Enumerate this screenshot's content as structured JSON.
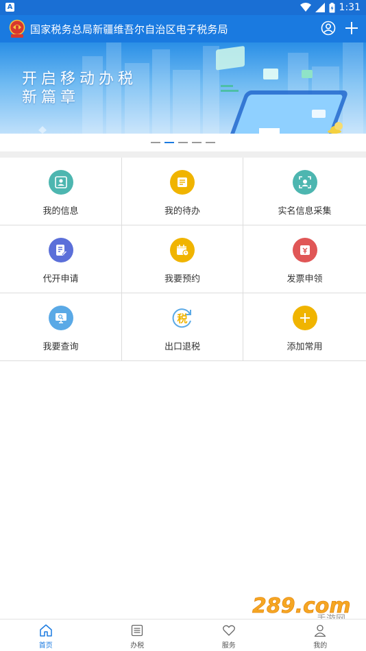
{
  "status_bar": {
    "time": "1:31",
    "sim_letter": "A"
  },
  "header": {
    "title": "国家税务总局新疆维吾尔自治区电子税务局",
    "emblem_text": "中国税务",
    "icons": [
      "user-circle-icon",
      "plus-icon"
    ]
  },
  "banner": {
    "line1": "开启移动办税",
    "line2": "新篇章",
    "slide_count": 5,
    "active_slide": 2
  },
  "grid": {
    "items": [
      {
        "label": "我的信息",
        "icon": "user-card-icon",
        "color": "#4db6b0"
      },
      {
        "label": "我的待办",
        "icon": "todo-list-icon",
        "color": "#f0b400"
      },
      {
        "label": "实名信息采集",
        "icon": "face-scan-icon",
        "color": "#4db6b0"
      },
      {
        "label": "代开申请",
        "icon": "document-edit-icon",
        "color": "#5b6fd9"
      },
      {
        "label": "我要预约",
        "icon": "calendar-clock-icon",
        "color": "#f0b400"
      },
      {
        "label": "发票申领",
        "icon": "invoice-icon",
        "color": "#e05656"
      },
      {
        "label": "我要查询",
        "icon": "monitor-search-icon",
        "color": "#5aa9e6"
      },
      {
        "label": "出口退税",
        "icon": "tax-refund-icon",
        "color": "#f0b400",
        "glyph": "税"
      },
      {
        "label": "添加常用",
        "icon": "add-icon",
        "color": "#f0b400"
      }
    ]
  },
  "watermark": {
    "text": "289.com",
    "sub": "手游网"
  },
  "tabbar": {
    "tabs": [
      {
        "label": "首页",
        "icon": "home-icon",
        "active": true
      },
      {
        "label": "办税",
        "icon": "list-icon",
        "active": false
      },
      {
        "label": "服务",
        "icon": "heart-icon",
        "active": false
      },
      {
        "label": "我的",
        "icon": "person-icon",
        "active": false
      }
    ]
  },
  "colors": {
    "accent": "#1a7ae0",
    "status_bar": "#1a6fd4"
  }
}
